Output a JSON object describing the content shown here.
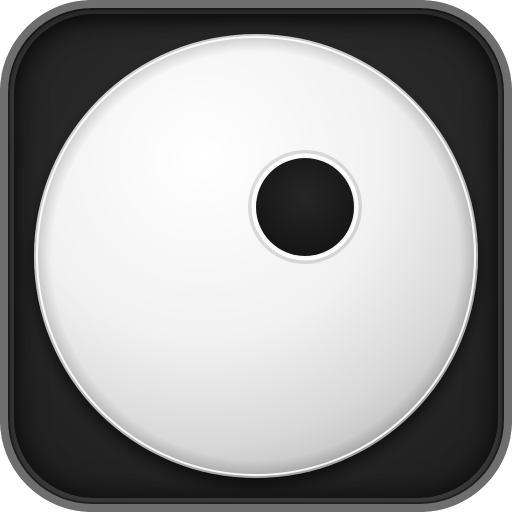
{
  "icon": {
    "symbol": "disc-icon",
    "colors": {
      "frame": "#6e6e6e",
      "background": "#2a2a2a",
      "disc_light": "#ffffff",
      "disc_shade": "#cfcfcf",
      "hole": "#1f1f1f"
    }
  }
}
